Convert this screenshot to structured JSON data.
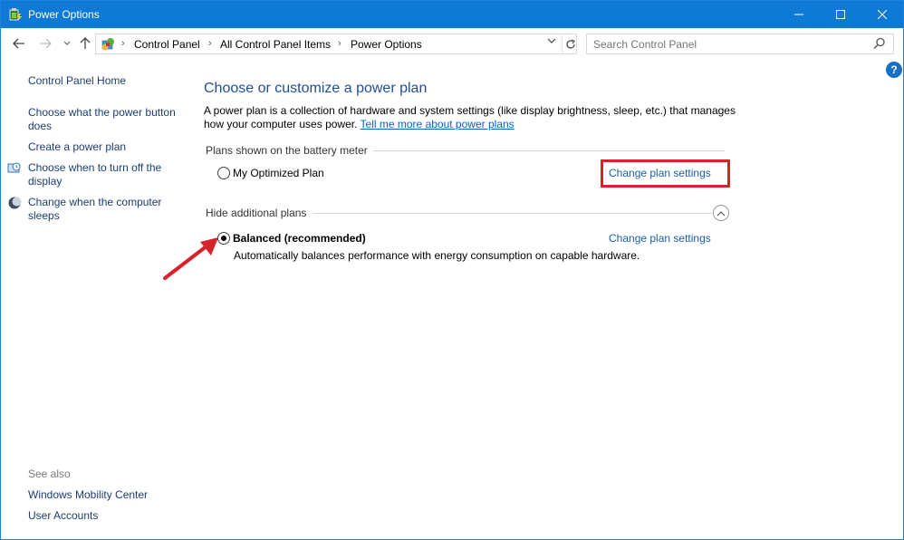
{
  "window": {
    "title": "Power Options"
  },
  "address": {
    "crumbs": [
      "Control Panel",
      "All Control Panel Items",
      "Power Options"
    ]
  },
  "search": {
    "placeholder": "Search Control Panel"
  },
  "help": {
    "label": "?"
  },
  "sidebar": {
    "home": "Control Panel Home",
    "items": [
      {
        "label": "Choose what the power button does",
        "icon": "none"
      },
      {
        "label": "Create a power plan",
        "icon": "none"
      },
      {
        "label": "Choose when to turn off the display",
        "icon": "display-clock-icon"
      },
      {
        "label": "Change when the computer sleeps",
        "icon": "moon-icon"
      }
    ],
    "see_also_title": "See also",
    "see_also": [
      "Windows Mobility Center",
      "User Accounts"
    ]
  },
  "main": {
    "heading": "Choose or customize a power plan",
    "description": "A power plan is a collection of hardware and system settings (like display brightness, sleep, etc.) that manages how your computer uses power.",
    "description_link": "Tell me more about power plans",
    "battery_meter_group": "Plans shown on the battery meter",
    "plans": [
      {
        "name": "My Optimized Plan",
        "selected": false,
        "link": "Change plan settings",
        "highlighted": true
      }
    ],
    "additional_group": "Hide additional plans",
    "additional_plans": [
      {
        "name": "Balanced (recommended)",
        "selected": true,
        "link": "Change plan settings",
        "description": "Automatically balances performance with energy consumption on capable hardware."
      }
    ]
  },
  "colors": {
    "titlebar": "#0f79d6",
    "link": "#1a5fb4",
    "highlight": "#d7212b",
    "annotation_arrow": "#d7212b"
  }
}
